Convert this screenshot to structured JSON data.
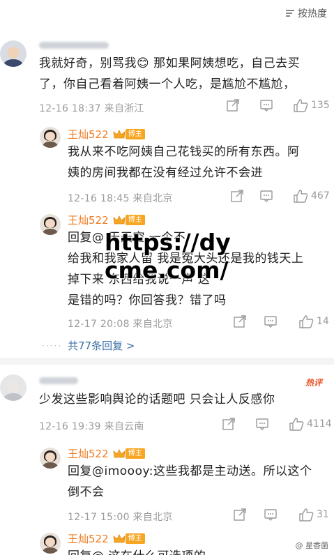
{
  "sort": {
    "label": "按热度"
  },
  "comments": [
    {
      "text_lines": [
        "我就好奇，别骂我😊 那如果阿姨想吃，自己去买",
        "了，你自己看着阿姨一个人吃，是尴尬不尴尬，"
      ],
      "meta": "12-16 18:37 来自浙江",
      "likes": "135"
    },
    {
      "text_lines": [
        "少发这些影响舆论的话题吧 只会让人反感你"
      ],
      "meta": "12-16 19:39 来自云南",
      "likes": "4114",
      "tag": "热评"
    }
  ],
  "replies": [
    {
      "username": "王灿522",
      "badge": "博主",
      "text_lines": [
        "我从来不吃阿姨自己花钱买的所有东西。阿",
        "姨的房间我都在没有经过允许不会进"
      ],
      "meta": "12-16 18:45 来自北京",
      "likes": "467"
    },
    {
      "username": "王灿522",
      "badge": "博主",
      "text_lines": [
        "回复@                 天天空 一个不",
        "给我和我家人留 我是冤大头还是我的钱天上",
        "掉下来                     东西给我说一声 这",
        "是错的吗？你回答我？错了吗"
      ],
      "meta": "12-17 20:08 来自北京",
      "likes": "14"
    },
    {
      "username": "王灿522",
      "badge": "博主",
      "text_lines": [
        "回复@imoooy:这些我都是主动送。所以这个",
        "倒不会"
      ],
      "meta": "12-17 15:00 来自北京",
      "likes": "31"
    },
    {
      "username": "王灿522",
      "badge": "博主",
      "text_lines": [
        "回复@                  这在什么可选项的"
      ]
    }
  ],
  "more_replies": "共77条回复 >",
  "watermark": [
    "https://dy",
    "cme.com/"
  ],
  "footer": "@ 星香菌"
}
